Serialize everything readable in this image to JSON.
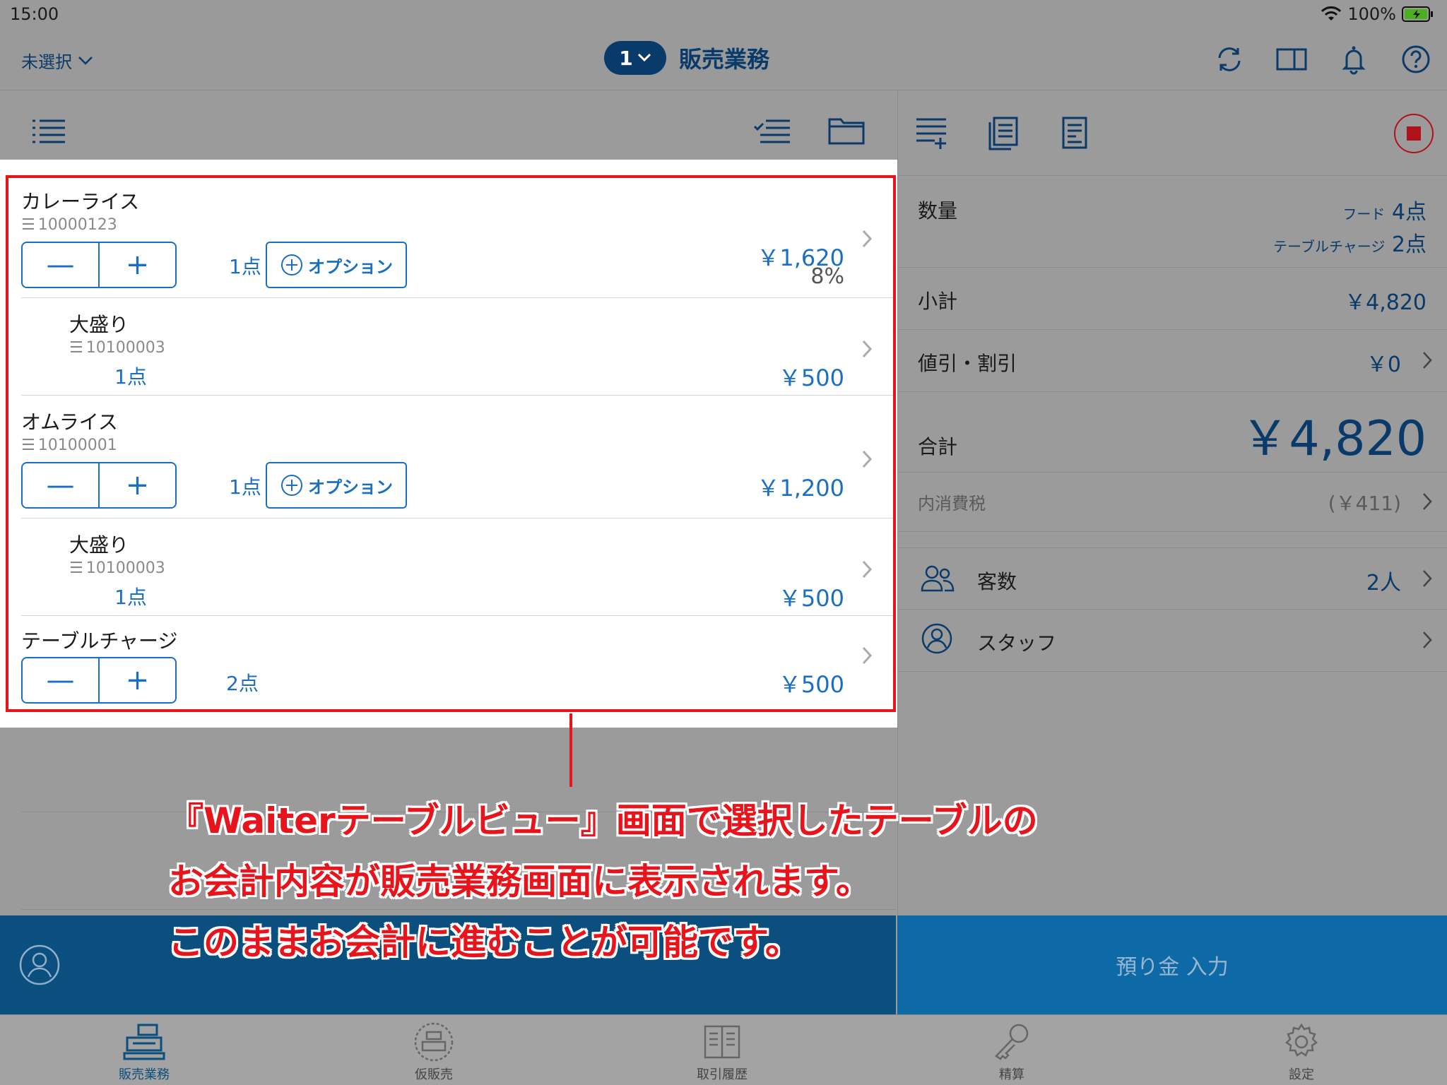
{
  "status": {
    "time": "15:00",
    "battery": "100%"
  },
  "header": {
    "unselected": "未選択",
    "order_number": "1",
    "title": "販売業務"
  },
  "items": [
    {
      "name": "カレーライス",
      "code": "10000123",
      "qty": "1点",
      "option_label": "オプション",
      "price": "￥1,620",
      "tax": "8%"
    },
    {
      "name": "大盛り",
      "code": "10100003",
      "qty": "1点",
      "price": "￥500"
    },
    {
      "name": "オムライス",
      "code": "10100001",
      "qty": "1点",
      "option_label": "オプション",
      "price": "￥1,200"
    },
    {
      "name": "大盛り",
      "code": "10100003",
      "qty": "1点",
      "price": "￥500"
    },
    {
      "name": "テーブルチャージ",
      "qty": "2点",
      "price": "￥500"
    }
  ],
  "summary": {
    "quantity_label": "数量",
    "food_label": "フード",
    "food_qty": "4点",
    "charge_label": "テーブルチャージ",
    "charge_qty": "2点",
    "subtotal_label": "小計",
    "subtotal": "￥4,820",
    "discount_label": "値引・割引",
    "discount": "￥0",
    "total_label": "合計",
    "total": "￥4,820",
    "tax_label": "内消費税",
    "tax": "(￥411)",
    "guests_label": "客数",
    "guests": "2人",
    "staff_label": "スタッフ"
  },
  "deposit_button": "預り金 入力",
  "tabs": [
    {
      "label": "販売業務"
    },
    {
      "label": "仮販売"
    },
    {
      "label": "取引履歴"
    },
    {
      "label": "精算"
    },
    {
      "label": "設定"
    }
  ],
  "annotation": {
    "line1": "『Waiterテーブルビュー』画面で選択したテーブルの",
    "line2": "お会計内容が販売業務画面に表示されます。",
    "line3": "このままお会計に進むことが可能です。"
  },
  "colors": {
    "accent": "#1a6fc4",
    "navy": "#0a3a6a",
    "highlight": "#e8141c",
    "bottom_bar": "#0a4f7e"
  }
}
